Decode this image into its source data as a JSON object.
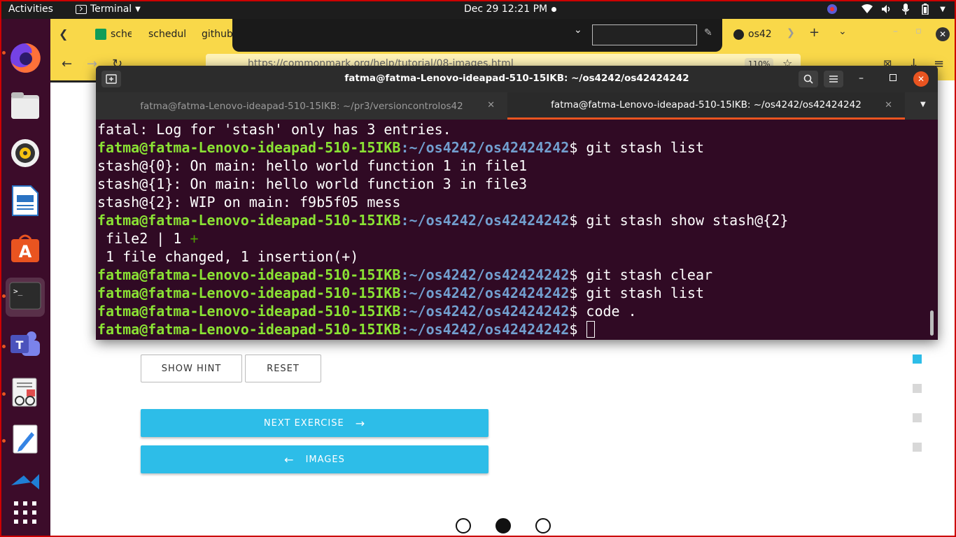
{
  "topbar": {
    "activities": "Activities",
    "app_name": "Terminal",
    "clock": "Dec 29  12:21 PM"
  },
  "dock": {
    "items": [
      "Firefox",
      "Files",
      "Rhythmbox",
      "LibreOffice Writer",
      "Ubuntu Software",
      "Terminal",
      "Microsoft Teams",
      "Document Viewer",
      "Text Editor",
      "Visual Studio Code",
      "Show Applications"
    ]
  },
  "browser": {
    "tabs": [
      "sche",
      "schedul",
      "github",
      "os42"
    ],
    "url": "https://commonmark.org/help/tutorial/08-images.html",
    "zoom": "110%"
  },
  "page": {
    "show_hint": "SHOW HINT",
    "reset": "RESET",
    "next_exercise": "NEXT EXERCISE",
    "next_arrow": "→",
    "back_arrow": "←",
    "images": "IMAGES"
  },
  "terminal": {
    "title": "fatma@fatma-Lenovo-ideapad-510-15IKB: ~/os4242/os42424242",
    "tabs": [
      "fatma@fatma-Lenovo-ideapad-510-15IKB: ~/pr3/versioncontrolos42",
      "fatma@fatma-Lenovo-ideapad-510-15IKB: ~/os4242/os42424242"
    ],
    "prompt_user": "fatma@fatma-Lenovo-ideapad-510-15IKB",
    "prompt_path": ":~/os4242/os42424242",
    "prompt_dollar": "$ ",
    "lines": {
      "l0": "fatal: Log for 'stash' only has 3 entries.",
      "c1": "git stash list",
      "l2": "stash@{0}: On main: hello world function 1 in file1",
      "l3": "stash@{1}: On main: hello world function 3 in file3",
      "l4": "stash@{2}: WIP on main: f9b5f05 mess",
      "c5": "git stash show stash@{2}",
      "l6": " file2 | 1 ",
      "l6_plus": "+",
      "l7": " 1 file changed, 1 insertion(+)",
      "c8": "git stash clear",
      "c9": "git stash list",
      "c10": "code .",
      "c11": ""
    }
  },
  "colors": {
    "terminal_bg": "#300a24",
    "prompt_user": "#8ae234",
    "prompt_path": "#729fcf",
    "browser_theme": "#f9d849",
    "accent_blue": "#2dbde8",
    "dock_bg": "#3c0c2a"
  }
}
